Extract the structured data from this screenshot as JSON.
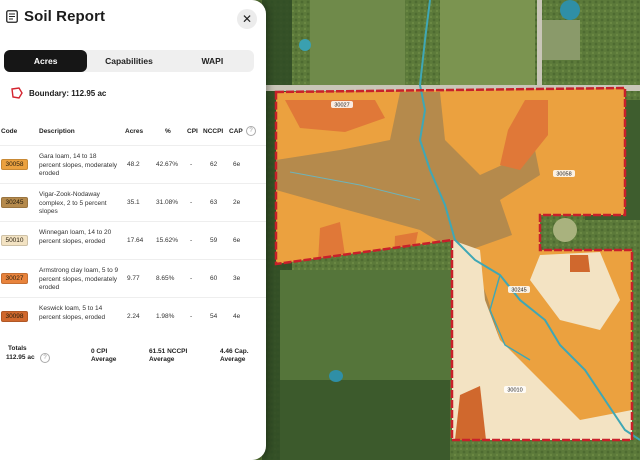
{
  "panel": {
    "title": "Soil Report",
    "close_icon": "close-icon",
    "tabs": [
      "Acres",
      "Capabilities",
      "WAPI"
    ],
    "active_tab": 0,
    "boundary_label": "Boundary: 112.95 ac",
    "columns": {
      "code": "Code",
      "description": "Description",
      "acres": "Acres",
      "percent": "%",
      "cpi": "CPI",
      "nccpi": "NCCPI",
      "cap": "CAP"
    },
    "rows": [
      {
        "code": "30058",
        "color": "#eba13f",
        "description": "Gara loam, 14 to 18 percent slopes, moderately eroded",
        "acres": "48.2",
        "percent": "42.67%",
        "cpi": "-",
        "nccpi": "62",
        "cap": "6e"
      },
      {
        "code": "30245",
        "color": "#b58a4c",
        "description": "Vigar-Zook-Nodaway complex, 2 to 5 percent slopes",
        "acres": "35.1",
        "percent": "31.08%",
        "cpi": "-",
        "nccpi": "63",
        "cap": "2e"
      },
      {
        "code": "50010",
        "color": "#f3e3c3",
        "description": "Winnegan loam, 14 to 20 percent slopes, eroded",
        "acres": "17.64",
        "percent": "15.62%",
        "cpi": "-",
        "nccpi": "59",
        "cap": "6e"
      },
      {
        "code": "30027",
        "color": "#e8833c",
        "description": "Armstrong clay loam, 5 to 9 percent slopes, moderately eroded",
        "acres": "9.77",
        "percent": "8.65%",
        "cpi": "-",
        "nccpi": "60",
        "cap": "3e"
      },
      {
        "code": "30098",
        "color": "#d0682d",
        "description": "Keswick loam, 5 to 14 percent slopes, eroded",
        "acres": "2.24",
        "percent": "1.98%",
        "cpi": "-",
        "nccpi": "54",
        "cap": "4e"
      }
    ],
    "totals": {
      "label": "Totals",
      "acres": "112.95 ac",
      "cpi_value": "0 CPI",
      "cpi_sub": "Average",
      "nccpi_value": "61.51 NCCPI",
      "nccpi_sub": "Average",
      "cap_value": "4.46 Cap.",
      "cap_sub": "Average"
    }
  },
  "map": {
    "boundary_color": "#c8202a",
    "stream_color": "#3fa7b5",
    "labels": [
      "30027",
      "30058",
      "30245",
      "30010"
    ]
  }
}
